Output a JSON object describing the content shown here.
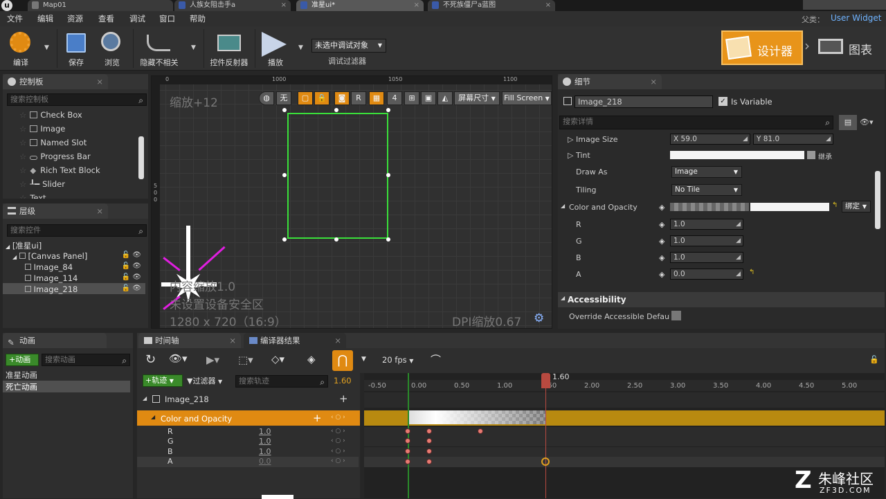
{
  "tabs": [
    {
      "label": "Map01"
    },
    {
      "label": "人族女阻击手a"
    },
    {
      "label": "准星ui*"
    },
    {
      "label": "不死族僵尸a蓝图"
    }
  ],
  "parent": {
    "label": "父类：",
    "value": "User Widget"
  },
  "menu": [
    "文件",
    "编辑",
    "资源",
    "查看",
    "调试",
    "窗口",
    "帮助"
  ],
  "toolbar": {
    "compile": "编译",
    "save": "保存",
    "browse": "浏览",
    "hide_unrelated": "隐藏不相关",
    "widget_reflector": "控件反射器",
    "play": "播放",
    "debug_select": "未选中调试对象",
    "debug_filter": "调试过滤器",
    "designer": "设计器",
    "graph": "图表"
  },
  "palette": {
    "title": "控制板",
    "search_placeholder": "搜索控制板",
    "items": [
      "Check Box",
      "Image",
      "Named Slot",
      "Progress Bar",
      "Rich Text Block",
      "Slider",
      "Text"
    ]
  },
  "hierarchy": {
    "title": "层级",
    "search_placeholder": "搜索控件",
    "root": "[准星ui]",
    "canvas": "[Canvas Panel]",
    "items": [
      "Image_84",
      "Image_114",
      "Image_218"
    ]
  },
  "viewport": {
    "zoom": "缩放+12",
    "ruler": [
      "0",
      "1000",
      "1050",
      "1100"
    ],
    "left_ruler": [
      "5",
      "0",
      "0"
    ],
    "btn_none": "无",
    "btn_r": "R",
    "btn_4": "4",
    "screen_size": "屏幕尺寸",
    "fill_screen": "Fill Screen",
    "overlay_1": "内容缩放1.0",
    "overlay_2": "未设置设备安全区",
    "overlay_3": "1280 x 720（16:9）",
    "dpi": "DPI缩放0.67"
  },
  "details": {
    "title": "细节",
    "name": "Image_218",
    "is_variable": "Is Variable",
    "search_placeholder": "搜索详情",
    "image_size": {
      "label": "Image Size",
      "x": "X  59.0",
      "y": "Y  81.0"
    },
    "tint": {
      "label": "Tint",
      "inherit": "继承"
    },
    "draw_as": {
      "label": "Draw As",
      "value": "Image"
    },
    "tiling": {
      "label": "Tiling",
      "value": "No Tile"
    },
    "color_opacity": {
      "label": "Color and Opacity",
      "bind": "绑定"
    },
    "r": {
      "label": "R",
      "value": "1.0"
    },
    "g": {
      "label": "G",
      "value": "1.0"
    },
    "b": {
      "label": "B",
      "value": "1.0"
    },
    "a": {
      "label": "A",
      "value": "0.0"
    },
    "accessibility": "Accessibility",
    "override_access": "Override Accessible Defaults"
  },
  "animations": {
    "title": "动画",
    "add": "动画",
    "search_placeholder": "搜索动画",
    "items": [
      "准星动画",
      "死亡动画"
    ]
  },
  "timeline": {
    "tab_timeline": "时间轴",
    "tab_compiler": "编译器结果",
    "fps": "20 fps",
    "track_btn": "轨迹",
    "filter_btn": "过滤器",
    "search_placeholder": "搜索轨迹",
    "current_time": "1.60",
    "playhead_label": "1.60",
    "track_obj": "Image_218",
    "track_prop": "Color and Opacity",
    "channels": [
      {
        "name": "R",
        "value": "1.0"
      },
      {
        "name": "G",
        "value": "1.0"
      },
      {
        "name": "B",
        "value": "1.0"
      },
      {
        "name": "A",
        "value": "0.0"
      }
    ],
    "ticks": [
      "-0.50",
      "0.00",
      "0.50",
      "1.00",
      "1.50",
      "2.00",
      "2.50",
      "3.00",
      "3.50",
      "4.00",
      "4.50",
      "5.00"
    ]
  },
  "watermark": {
    "brand": "朱峰社区",
    "url": "ZF3D.COM"
  },
  "colors": {
    "accent": "#e08a12",
    "selection_green": "#3ae03a",
    "magenta": "#e01ee0"
  }
}
